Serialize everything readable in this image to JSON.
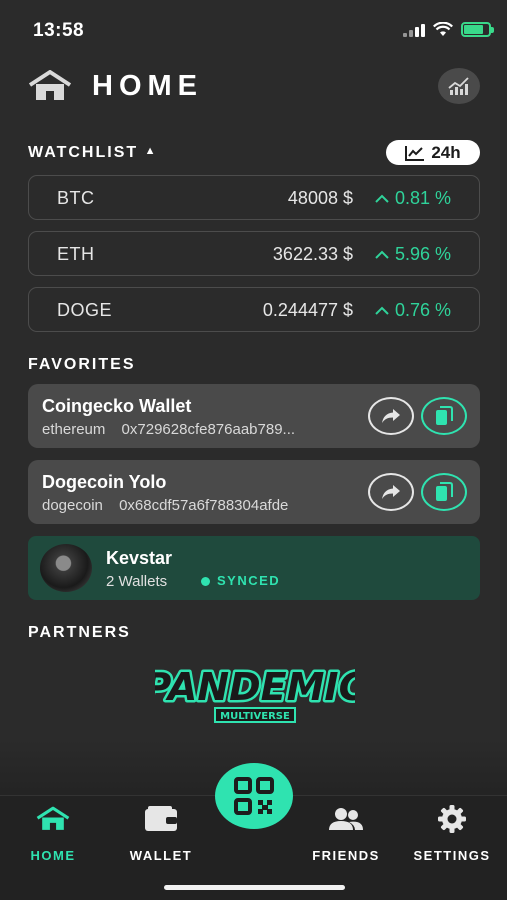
{
  "status_bar": {
    "time": "13:58"
  },
  "header": {
    "title": "HOME"
  },
  "watchlist": {
    "label": "WATCHLIST",
    "timeframe": "24h",
    "items": [
      {
        "symbol": "BTC",
        "price": "48008 $",
        "change": "0.81 %"
      },
      {
        "symbol": "ETH",
        "price": "3622.33 $",
        "change": "5.96 %"
      },
      {
        "symbol": "DOGE",
        "price": "0.244477 $",
        "change": "0.76 %"
      }
    ]
  },
  "favorites": {
    "label": "FAVORITES",
    "items": [
      {
        "name": "Coingecko Wallet",
        "chain": "ethereum",
        "address": "0x729628cfe876aab789..."
      },
      {
        "name": "Dogecoin Yolo",
        "chain": "dogecoin",
        "address": "0x68cdf57a6f788304afde"
      }
    ]
  },
  "user": {
    "name": "Kevstar",
    "wallets": "2 Wallets",
    "status": "SYNCED"
  },
  "partners": {
    "label": "PARTNERS",
    "logo_main": "PANDEMIC",
    "logo_sub": "MULTIVERSE"
  },
  "tabs": [
    {
      "label": "HOME",
      "icon": "home-icon"
    },
    {
      "label": "WALLET",
      "icon": "wallet-icon"
    },
    {
      "label": "FRIENDS",
      "icon": "friends-icon"
    },
    {
      "label": "SETTINGS",
      "icon": "gear-icon"
    }
  ],
  "colors": {
    "accent": "#2fe3b0",
    "positive": "#2fd39a",
    "background": "#2b2b2b",
    "synced_card": "#1f4a3d"
  }
}
